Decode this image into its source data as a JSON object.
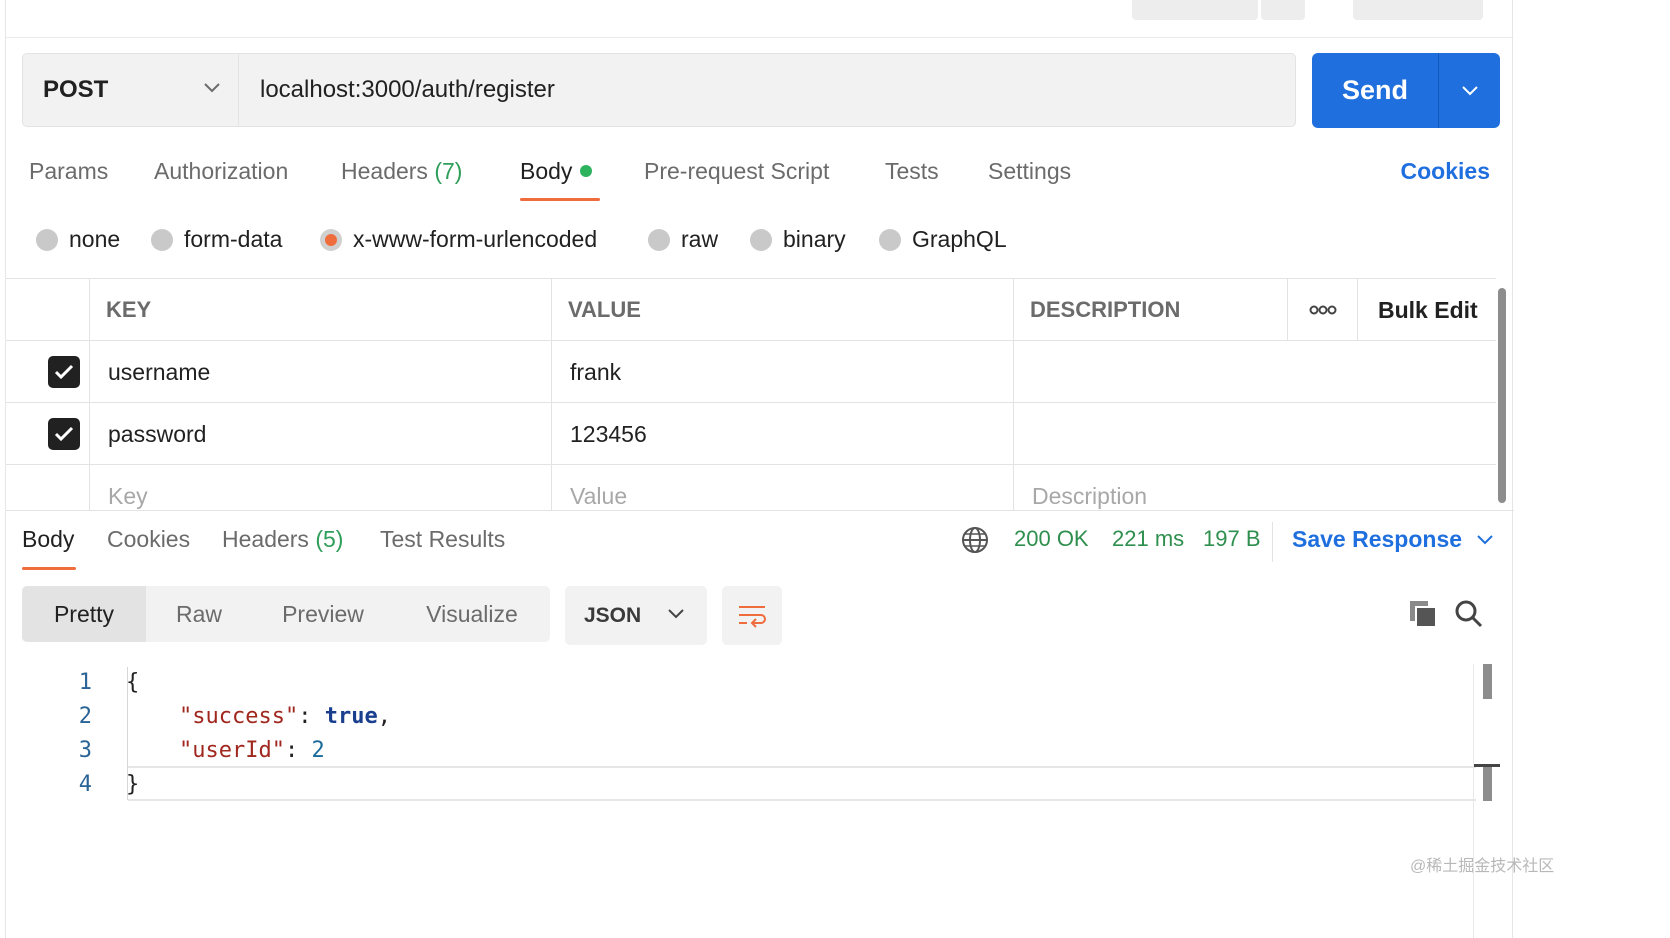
{
  "request": {
    "method": "POST",
    "url": "localhost:3000/auth/register",
    "send_label": "Send"
  },
  "request_tabs": {
    "items": [
      {
        "label": "Params",
        "count": ""
      },
      {
        "label": "Authorization",
        "count": ""
      },
      {
        "label": "Headers",
        "count": "(7)"
      },
      {
        "label": "Body",
        "count": ""
      },
      {
        "label": "Pre-request Script",
        "count": ""
      },
      {
        "label": "Tests",
        "count": ""
      },
      {
        "label": "Settings",
        "count": ""
      }
    ],
    "active": "Body",
    "cookies_label": "Cookies"
  },
  "body_types": {
    "options": [
      "none",
      "form-data",
      "x-www-form-urlencoded",
      "raw",
      "binary",
      "GraphQL"
    ],
    "selected": "x-www-form-urlencoded"
  },
  "params_table": {
    "headers": {
      "key": "KEY",
      "value": "VALUE",
      "description": "DESCRIPTION",
      "more": "ooo",
      "bulk_edit": "Bulk Edit"
    },
    "rows": [
      {
        "checked": true,
        "key": "username",
        "value": "frank",
        "description": ""
      },
      {
        "checked": true,
        "key": "password",
        "value": "123456",
        "description": ""
      }
    ],
    "placeholders": {
      "key": "Key",
      "value": "Value",
      "description": "Description"
    }
  },
  "response": {
    "tabs": [
      {
        "label": "Body",
        "count": ""
      },
      {
        "label": "Cookies",
        "count": ""
      },
      {
        "label": "Headers",
        "count": "(5)"
      },
      {
        "label": "Test Results",
        "count": ""
      }
    ],
    "active_tab": "Body",
    "status": "200 OK",
    "time": "221 ms",
    "size": "197 B",
    "save_label": "Save Response",
    "views": [
      "Pretty",
      "Raw",
      "Preview",
      "Visualize"
    ],
    "active_view": "Pretty",
    "format": "JSON",
    "code_lines": [
      "1",
      "2",
      "3",
      "4"
    ],
    "json": {
      "open": "{",
      "close": "}",
      "key1": "\"success\"",
      "val1": "true",
      "key2": "\"userId\"",
      "val2": "2"
    }
  },
  "watermark": "@稀土掘金技术社区",
  "colors": {
    "accent": "#ef6c3d",
    "primary": "#1f6fde",
    "success": "#2f8f4e"
  },
  "icons": [
    "chevron-down-icon",
    "checkmark-icon",
    "globe-icon",
    "wrap-lines-icon",
    "copy-icon",
    "search-icon",
    "more-icon"
  ]
}
